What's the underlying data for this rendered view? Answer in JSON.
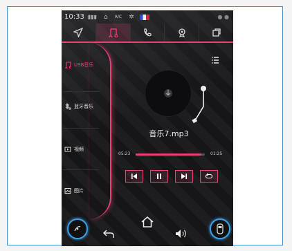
{
  "status_bar": {
    "time": "10:33",
    "ac_label": "A/C",
    "icons": [
      "signal-icon",
      "car-icon",
      "fan-icon",
      "flag-icon"
    ]
  },
  "top_nav": {
    "tabs": [
      {
        "icon": "navigation-icon"
      },
      {
        "icon": "music-icon",
        "active": true
      },
      {
        "icon": "phone-icon"
      },
      {
        "icon": "settings-badge-icon"
      },
      {
        "icon": "copy-icon"
      }
    ]
  },
  "sidebar": {
    "items": [
      {
        "label": "USB音乐",
        "icon": "usb-music-icon",
        "active": true
      },
      {
        "label": "蓝牙音乐",
        "icon": "bluetooth-music-icon"
      },
      {
        "label": "视频",
        "icon": "video-icon"
      },
      {
        "label": "图片",
        "icon": "image-icon"
      }
    ]
  },
  "player": {
    "song_title": "音乐7.mp3",
    "current_time": "05:23",
    "total_time": "01:25",
    "progress": 0.95,
    "controls": [
      "previous-icon",
      "pause-icon",
      "next-icon",
      "repeat-icon"
    ]
  },
  "bottom_bar": {
    "items": [
      "climate-dial-icon",
      "back-arrow-icon",
      "home-icon",
      "volume-icon",
      "car-status-icon"
    ]
  },
  "colors": {
    "accent": "#e84172",
    "background": "#161618",
    "ring": "#3ba0e6"
  }
}
